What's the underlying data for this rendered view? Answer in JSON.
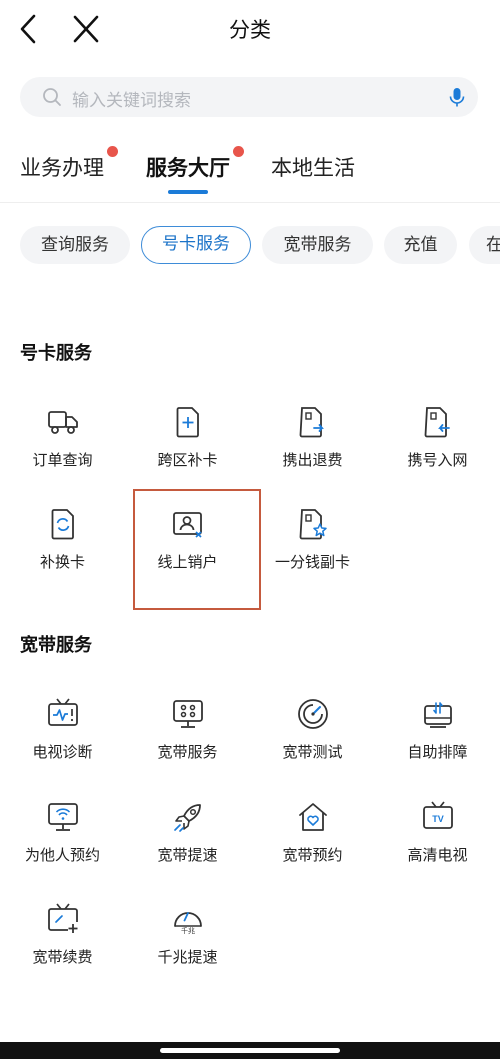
{
  "nav": {
    "title": "分类"
  },
  "search": {
    "placeholder": "输入关键词搜索"
  },
  "tabs": [
    {
      "label": "业务办理",
      "badge": true,
      "active": false
    },
    {
      "label": "服务大厅",
      "badge": true,
      "active": true
    },
    {
      "label": "本地生活",
      "badge": false,
      "active": false
    }
  ],
  "chips": [
    {
      "label": "查询服务",
      "active": false
    },
    {
      "label": "号卡服务",
      "active": true
    },
    {
      "label": "宽带服务",
      "active": false
    },
    {
      "label": "充值",
      "active": false
    },
    {
      "label": "在",
      "active": false
    }
  ],
  "sections": [
    {
      "title": "号卡服务",
      "items": [
        {
          "label": "订单查询",
          "icon": "truck-icon"
        },
        {
          "label": "跨区补卡",
          "icon": "sim-plus-icon"
        },
        {
          "label": "携出退费",
          "icon": "sim-export-icon"
        },
        {
          "label": "携号入网",
          "icon": "sim-import-icon"
        },
        {
          "label": "补换卡",
          "icon": "sim-refresh-icon"
        },
        {
          "label": "线上销户",
          "icon": "id-card-close-icon"
        },
        {
          "label": "一分钱副卡",
          "icon": "sim-star-icon"
        }
      ]
    },
    {
      "title": "宽带服务",
      "items": [
        {
          "label": "电视诊断",
          "icon": "tv-pulse-icon"
        },
        {
          "label": "宽带服务",
          "icon": "router-icon"
        },
        {
          "label": "宽带测试",
          "icon": "speed-test-icon"
        },
        {
          "label": "自助排障",
          "icon": "modem-icon"
        },
        {
          "label": "为他人预约",
          "icon": "wifi-monitor-icon"
        },
        {
          "label": "宽带提速",
          "icon": "rocket-icon"
        },
        {
          "label": "宽带预约",
          "icon": "home-heart-icon"
        },
        {
          "label": "高清电视",
          "icon": "tv-icon"
        },
        {
          "label": "宽带续费",
          "icon": "tv-plus-icon"
        },
        {
          "label": "千兆提速",
          "icon": "gauge-icon"
        }
      ],
      "gauge_text": "千兆",
      "tv_text": "TV"
    }
  ],
  "colors": {
    "accent": "#1b7bd8",
    "badge": "#e8554b",
    "highlight": "#c55a3e"
  }
}
